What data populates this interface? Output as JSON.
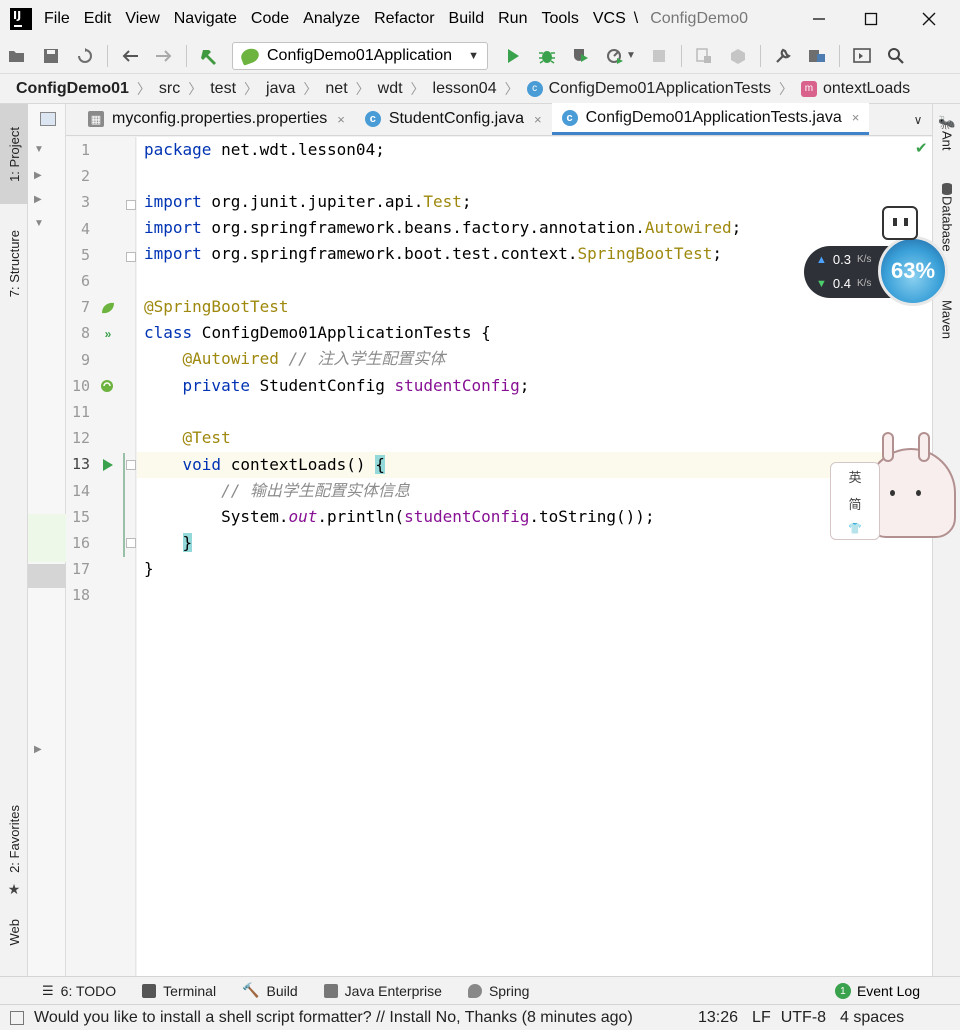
{
  "window": {
    "title": "ConfigDemo0",
    "logo_text": "IJ"
  },
  "menu": [
    "File",
    "Edit",
    "View",
    "Navigate",
    "Code",
    "Analyze",
    "Refactor",
    "Build",
    "Run",
    "Tools",
    "VCS",
    "\\"
  ],
  "toolbar": {
    "run_config": "ConfigDemo01Application"
  },
  "breadcrumb": [
    "ConfigDemo01",
    "src",
    "test",
    "java",
    "net",
    "wdt",
    "lesson04",
    "ConfigDemo01ApplicationTests",
    "ontextLoads"
  ],
  "left_tools": {
    "project": "1: Project",
    "structure": "7: Structure",
    "favorites": "2: Favorites",
    "web": "Web"
  },
  "right_tools": {
    "ant": "Ant",
    "database": "Database",
    "maven": "Maven"
  },
  "tabs": [
    {
      "label": "myconfig.properties.properties",
      "icon": "properties-file-icon",
      "active": false
    },
    {
      "label": "StudentConfig.java",
      "icon": "class-icon",
      "active": false
    },
    {
      "label": "ConfigDemo01ApplicationTests.java",
      "icon": "class-icon",
      "active": true
    }
  ],
  "tab_close": "×",
  "editor": {
    "line_numbers": [
      "1",
      "2",
      "3",
      "4",
      "5",
      "6",
      "7",
      "8",
      "9",
      "10",
      "11",
      "12",
      "13",
      "14",
      "15",
      "16",
      "17",
      "18"
    ],
    "current_line": 13
  },
  "code": {
    "l1_kw": "package",
    "l1_rest": " net.wdt.lesson04;",
    "l3_kw": "import",
    "l3_rest": " org.junit.jupiter.api.",
    "l3_cls": "Test",
    "l3_end": ";",
    "l4_kw": "import",
    "l4_rest": " org.springframework.beans.factory.annotation.",
    "l4_cls": "Autowired",
    "l4_end": ";",
    "l5_kw": "import",
    "l5_rest": " org.springframework.boot.test.context.",
    "l5_cls": "SpringBootTest",
    "l5_end": ";",
    "l7_ann": "@SpringBootTest",
    "l8_kw": "class",
    "l8_rest": " ConfigDemo01ApplicationTests {",
    "l9_ann": "    @Autowired",
    "l9_cmt": " // 注入学生配置实体",
    "l10_kw": "    private",
    "l10_typ": " StudentConfig ",
    "l10_fld": "studentConfig",
    "l10_end": ";",
    "l12_ann": "    @Test",
    "l13_kw": "    void",
    "l13_rest": " contextLoads() ",
    "l13_brace": "{",
    "l14_cmt": "        // 输出学生配置实体信息",
    "l15_a": "        System.",
    "l15_out": "out",
    "l15_b": ".println(",
    "l15_fld": "studentConfig",
    "l15_c": ".toString());",
    "l16_indent": "    ",
    "l16_brace": "}",
    "l17": "}"
  },
  "net_widget": {
    "up": "0.3",
    "down": "0.4",
    "unit": "K/s",
    "percent": "63%"
  },
  "ime": {
    "char1": "英",
    "char2": "简"
  },
  "bottom_tools": [
    "6: TODO",
    "Terminal",
    "Build",
    "Java Enterprise",
    "Spring"
  ],
  "event_log": "Event Log",
  "status": {
    "message": "Would you like to install a shell script formatter? // Install   No, Thanks (8 minutes ago)",
    "position": "13:26",
    "line_sep": "LF",
    "encoding": "UTF-8",
    "indent": "4 spaces"
  },
  "colors": {
    "accent": "#4083c9",
    "keyword": "#0033b3",
    "annotation": "#9e880d",
    "field": "#871094",
    "run_green": "#3aa14c"
  }
}
